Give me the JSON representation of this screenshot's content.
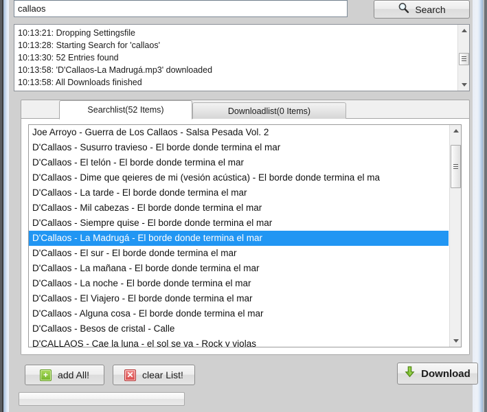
{
  "search": {
    "query": "callaos",
    "placeholder": "",
    "button_label": "Search",
    "icon": "magnifier-icon"
  },
  "log": {
    "lines": [
      "10:13:21: Dropping Settingsfile",
      "10:13:28: Starting Search for 'callaos'",
      "10:13:30: 52 Entries found",
      "10:13:58: 'D'Callaos-La Madrugá.mp3' downloaded",
      "10:13:58: All Downloads finished"
    ]
  },
  "tabs": [
    {
      "label": "Searchlist(52 Items)",
      "active": true
    },
    {
      "label": "Downloadlist(0 Items)",
      "active": false
    }
  ],
  "results": {
    "selected_index": 7,
    "items": [
      "Joe Arroyo - Guerra de Los Callaos - Salsa Pesada Vol. 2",
      "D'Callaos - Susurro travieso - El borde donde termina el mar",
      "D'Callaos - El telón - El borde donde termina el mar",
      "D'Callaos - Dime que qeieres de mi (vesión acústica) - El borde donde termina el ma",
      "D'Callaos - La tarde - El borde donde termina el mar",
      "D'Callaos - Mil cabezas - El borde donde termina el mar",
      "D'Callaos - Siempre quise - El borde donde termina el mar",
      "D'Callaos - La Madrugá - El borde donde termina el mar",
      "D'Callaos - El sur - El borde donde termina el mar",
      "D'Callaos - La mañana - El borde donde termina el mar",
      "D'Callaos - La noche - El borde donde termina el mar",
      "D'Callaos - El Viajero - El borde donde termina el mar",
      "D'Callaos - Alguna cosa - El borde donde termina el mar",
      "D'Callaos - Besos de cristal - Calle",
      "D'CALLAOS - Cae la luna - el sol se va - Rock y violas"
    ]
  },
  "actions": {
    "add_all_label": "add All!",
    "add_all_icon": "plus-square-green-icon",
    "clear_list_label": "clear List!",
    "clear_list_icon": "x-square-red-icon",
    "download_label": "Download",
    "download_icon": "down-arrow-green-icon"
  },
  "progress": {
    "percent": 0,
    "value_text": ""
  },
  "colors": {
    "selection": "#2196f3",
    "accent_green": "#74b42c",
    "accent_red": "#d94b4b",
    "window_chrome": "#d0d0d0"
  },
  "scrollbars": {
    "log": {
      "thumb_top_pct": 38,
      "thumb_height_pct": 30
    },
    "results": {
      "thumb_top_pct": 4,
      "thumb_height_pct": 22
    }
  }
}
